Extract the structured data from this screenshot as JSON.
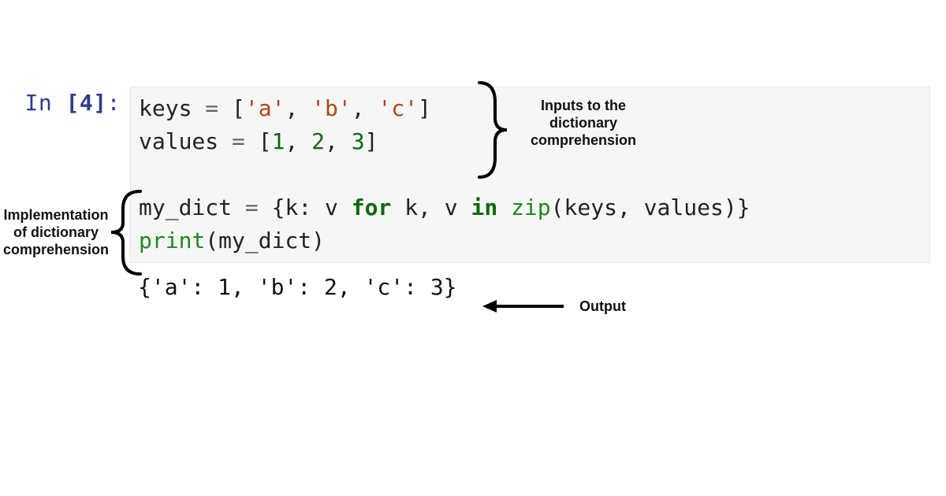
{
  "prompt": {
    "label": "In",
    "number": "[4]",
    "colon": ":"
  },
  "code": {
    "line1": {
      "var": "keys",
      "items": [
        "'a'",
        "'b'",
        "'c'"
      ]
    },
    "line2": {
      "var": "values",
      "items": [
        "1",
        "2",
        "3"
      ]
    },
    "line4": {
      "lhs": "my_dict",
      "k": "k",
      "v": "v",
      "for": "for",
      "in": "in",
      "zip": "zip",
      "arg1": "keys",
      "arg2": "values"
    },
    "line5": {
      "fn": "print",
      "arg": "my_dict"
    }
  },
  "output": "{'a': 1, 'b': 2, 'c': 3}",
  "annotations": {
    "inputs": "Inputs to the\ndictionary\ncomprehension",
    "impl": "Implementation\nof dictionary\ncomprehension",
    "output": "Output"
  },
  "syntax_tokens": {
    "eq": " = ",
    "lb": "[",
    "rb": "]",
    "comma": ", ",
    "lc": "{",
    "rc": "}",
    "colon": ": ",
    "lp": "(",
    "rp": ")"
  }
}
